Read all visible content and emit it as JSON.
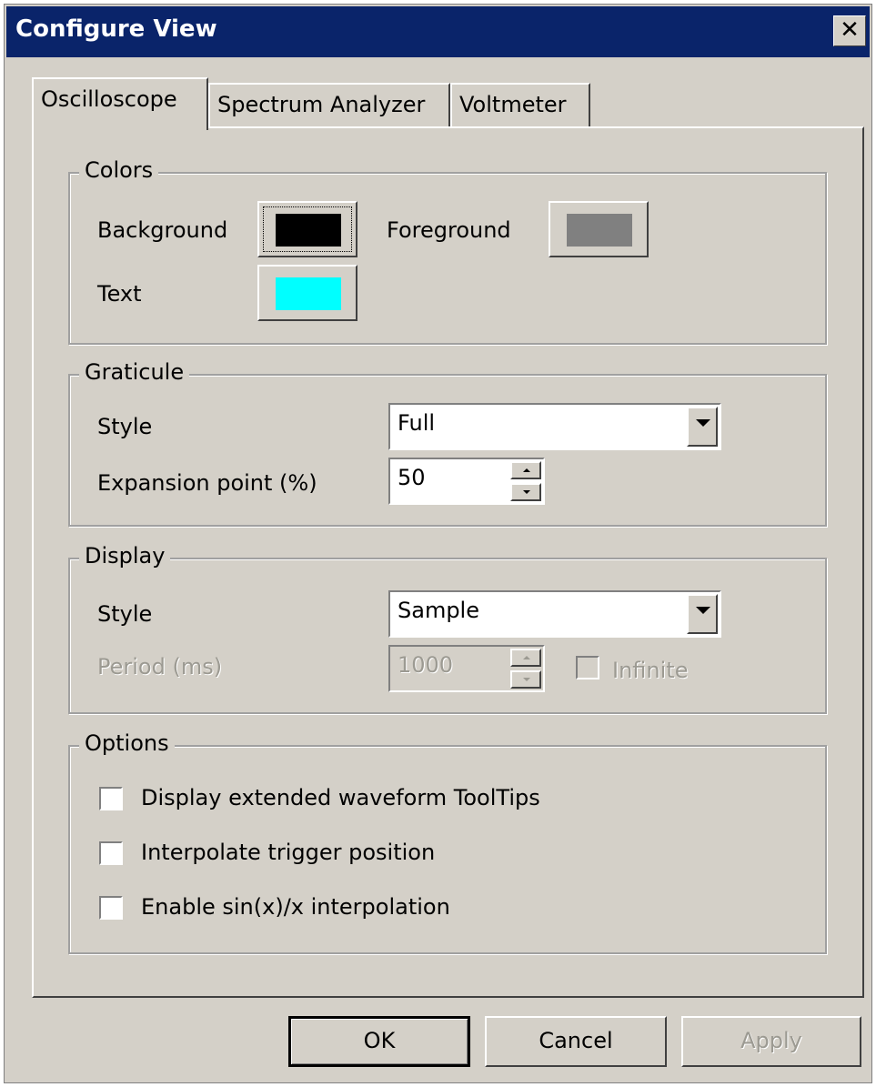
{
  "window": {
    "title": "Configure View",
    "close_label": "✕"
  },
  "tabs": [
    {
      "label": "Oscilloscope",
      "active": true
    },
    {
      "label": "Spectrum Analyzer",
      "active": false
    },
    {
      "label": "Voltmeter",
      "active": false
    }
  ],
  "colors": {
    "legend": "Colors",
    "background_label": "Background",
    "background_color": "#000000",
    "foreground_label": "Foreground",
    "foreground_color": "#808080",
    "text_label": "Text",
    "text_color": "#00ffff"
  },
  "graticule": {
    "legend": "Graticule",
    "style_label": "Style",
    "style_value": "Full",
    "expansion_label": "Expansion point (%)",
    "expansion_value": "50"
  },
  "display": {
    "legend": "Display",
    "style_label": "Style",
    "style_value": "Sample",
    "period_label": "Period (ms)",
    "period_value": "1000",
    "infinite_label": "Infinite"
  },
  "options": {
    "legend": "Options",
    "items": [
      {
        "label": "Display extended waveform ToolTips",
        "checked": false
      },
      {
        "label": "Interpolate trigger position",
        "checked": false
      },
      {
        "label": "Enable sin(x)/x interpolation",
        "checked": false
      }
    ]
  },
  "buttons": {
    "ok": "OK",
    "cancel": "Cancel",
    "apply": "Apply"
  }
}
